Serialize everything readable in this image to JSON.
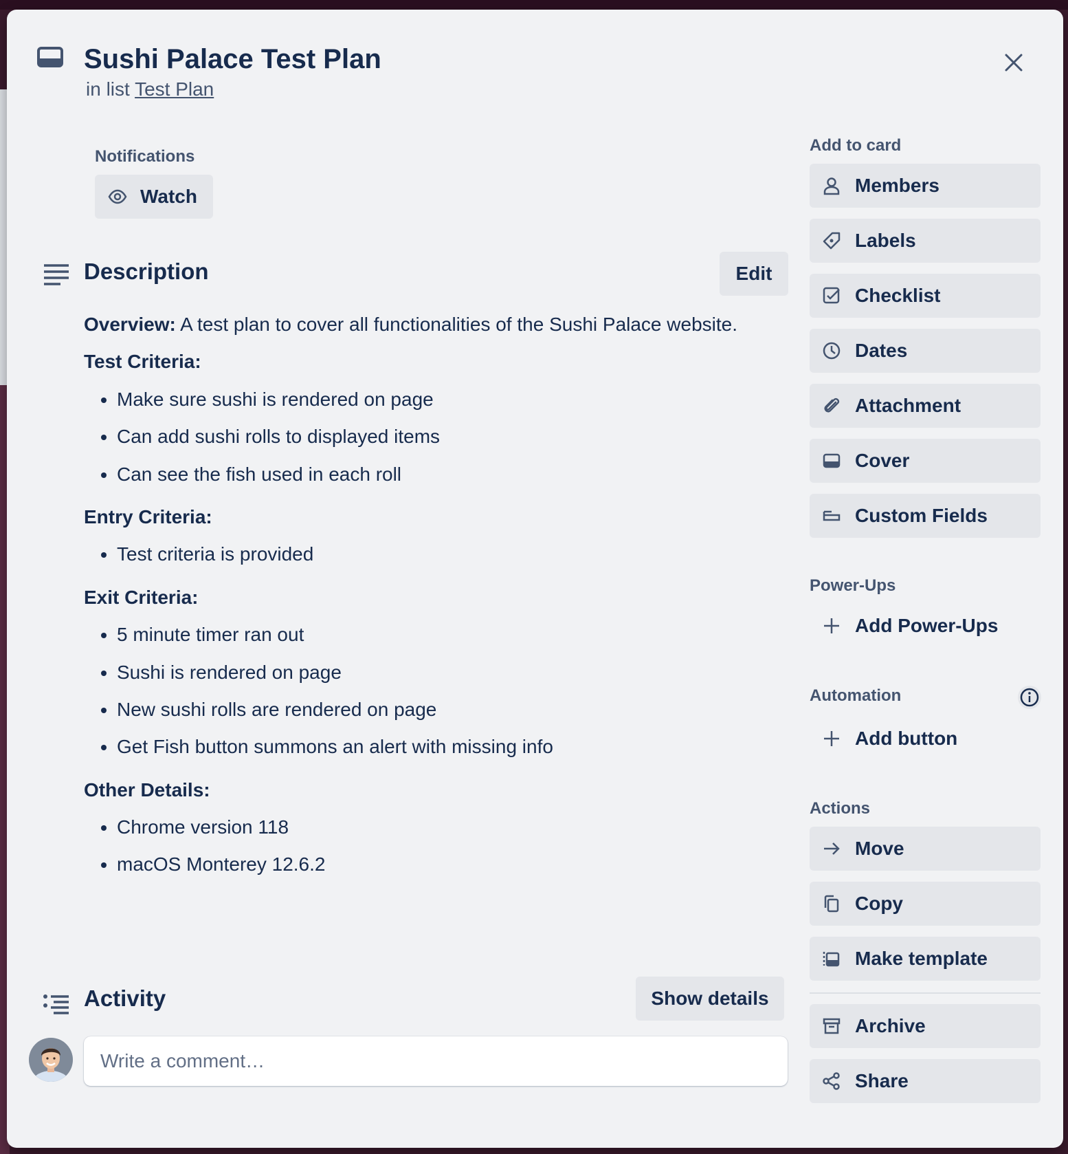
{
  "card": {
    "title": "Sushi Palace Test Plan",
    "list_prefix": "in list",
    "list_name": "Test Plan"
  },
  "notifications": {
    "label": "Notifications",
    "watch_label": "Watch"
  },
  "description": {
    "heading": "Description",
    "edit_label": "Edit",
    "overview_label": "Overview:",
    "overview_text": "A test plan to cover all functionalities of the Sushi Palace website.",
    "sections": [
      {
        "heading": "Test Criteria:",
        "items": [
          "Make sure sushi is rendered on page",
          "Can add sushi rolls to displayed items",
          "Can see the fish used in each roll"
        ]
      },
      {
        "heading": "Entry Criteria:",
        "items": [
          "Test criteria is provided"
        ]
      },
      {
        "heading": "Exit Criteria:",
        "items": [
          "5 minute timer ran out",
          "Sushi is rendered on page",
          "New sushi rolls are rendered on page",
          "Get Fish button summons an alert with missing info"
        ]
      },
      {
        "heading": "Other Details:",
        "items": [
          "Chrome version 118",
          "macOS Monterey 12.6.2"
        ]
      }
    ]
  },
  "activity": {
    "heading": "Activity",
    "show_details_label": "Show details",
    "comment_placeholder": "Write a comment…"
  },
  "sidebar": {
    "add_to_card_label": "Add to card",
    "add_to_card": [
      {
        "label": "Members",
        "icon": "person-icon"
      },
      {
        "label": "Labels",
        "icon": "tag-icon"
      },
      {
        "label": "Checklist",
        "icon": "checkbox-icon"
      },
      {
        "label": "Dates",
        "icon": "clock-icon"
      },
      {
        "label": "Attachment",
        "icon": "paperclip-icon"
      },
      {
        "label": "Cover",
        "icon": "cover-icon"
      },
      {
        "label": "Custom Fields",
        "icon": "custom-fields-icon"
      }
    ],
    "power_ups_label": "Power-Ups",
    "add_power_ups_label": "Add Power-Ups",
    "automation_label": "Automation",
    "add_button_label": "Add button",
    "actions_label": "Actions",
    "actions": [
      {
        "label": "Move",
        "icon": "arrow-right-icon"
      },
      {
        "label": "Copy",
        "icon": "copy-icon"
      },
      {
        "label": "Make template",
        "icon": "template-icon"
      },
      {
        "label": "Archive",
        "icon": "archive-icon"
      },
      {
        "label": "Share",
        "icon": "share-icon"
      }
    ]
  }
}
